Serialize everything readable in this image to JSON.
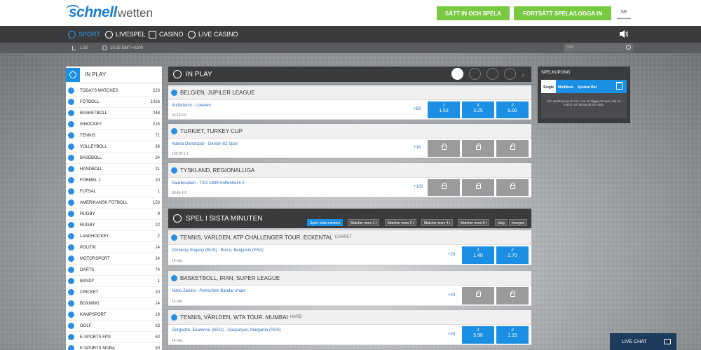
{
  "header": {
    "logo_main": "schnell",
    "logo_sub": "wetten",
    "btn_deposit": "SÄTT IN OCH SPELA",
    "btn_login": "FORTSÄTT SPELA/LOGGA IN",
    "lang": "SE"
  },
  "nav": {
    "sport": "SPORT",
    "livespel": "LIVESPEL",
    "casino": "CASINO",
    "live_casino": "LIVE CASINO"
  },
  "subnav": {
    "odds_format": "1.50",
    "time": "15:15 GMT+0100",
    "search_placeholder": "Sök"
  },
  "sidebar": {
    "title": "IN PLAY",
    "items": [
      {
        "name": "TODAYS MATCHES",
        "count": "223"
      },
      {
        "name": "FOTBOLL",
        "count": "1026"
      },
      {
        "name": "BASKETBOLL",
        "count": "248"
      },
      {
        "name": "ISHOCKEY",
        "count": "215"
      },
      {
        "name": "TENNIS",
        "count": "71"
      },
      {
        "name": "VOLLEYBOLL",
        "count": "36"
      },
      {
        "name": "BASEBOLL",
        "count": "24"
      },
      {
        "name": "HANDBOLL",
        "count": "21"
      },
      {
        "name": "FORMEL 1",
        "count": "20"
      },
      {
        "name": "FUTSAL",
        "count": "1"
      },
      {
        "name": "AMERIKANSK FOTBOLL",
        "count": "153"
      },
      {
        "name": "RUGBY",
        "count": "9"
      },
      {
        "name": "RUGBY",
        "count": "22"
      },
      {
        "name": "LANDHOCKEY",
        "count": "2"
      },
      {
        "name": "POLITIK",
        "count": "14"
      },
      {
        "name": "MOTORSPORT",
        "count": "14"
      },
      {
        "name": "DARTS",
        "count": "74"
      },
      {
        "name": "BANDY",
        "count": "1"
      },
      {
        "name": "CRICKET",
        "count": "20"
      },
      {
        "name": "BOXNING",
        "count": "14"
      },
      {
        "name": "KAMPSPORT",
        "count": "19"
      },
      {
        "name": "GOLF",
        "count": "33"
      },
      {
        "name": "E-SPORTS FPS",
        "count": "63"
      },
      {
        "name": "E-SPORTS MOBA",
        "count": "30"
      }
    ]
  },
  "inplay": {
    "title": "IN PLAY",
    "leagues": [
      {
        "name": "BELGIEN, JUPILER LEAGUE",
        "event": "Anderlecht - Lokeren",
        "time": "43:19 0-0",
        "more": "+83",
        "odds": [
          {
            "lab": "1",
            "val": "1.53"
          },
          {
            "lab": "X",
            "val": "3.25"
          },
          {
            "lab": "2",
            "val": "9.00"
          }
        ]
      },
      {
        "name": "TURKIET, TURKEY CUP",
        "event": "Adana Demirspor - Dersim 62 Spor",
        "time": "106:00 1-1",
        "more": "+18"
      },
      {
        "name": "TYSKLAND, REGIONALLIGA",
        "event": "Saarbrucken - TSG 1899 Hoffenheim II",
        "time": "58:45 4-0",
        "more": "+102"
      }
    ]
  },
  "lastminute": {
    "title": "SPEL I SISTA MINUTEN",
    "tabs": [
      "Spel i sista minuten",
      "Matcher inom 1 t",
      "Matcher inom 2 t",
      "Matcher inom 4 t",
      "Matcher inom 8 t",
      "Idag",
      "Imorgon"
    ],
    "leagues": [
      {
        "name": "TENNIS, VÄRLDEN, ATP CHALLENGER TOUR. ECKENTAL",
        "sub": "CARPET",
        "event": "Donskoy, Evgeny (RUS) - Bonzi, Benjamin (FRA)",
        "time": "14 min.",
        "more": "+20",
        "odds": [
          {
            "lab": "1",
            "val": "1.40"
          },
          {
            "lab": "2",
            "val": "2.70"
          }
        ]
      },
      {
        "name": "BASKETBOLL, IRAN, SUPER LEAGUE",
        "sub": "",
        "event": "Niroo Zamini - Petrochimi Bandar Imam",
        "time": "14 min.",
        "more": "+24"
      },
      {
        "name": "TENNIS, VÄRLDEN, WTA TOUR. MUMBAI",
        "sub": "HARD",
        "event": "Gorgodze, Ekaterine (GEO) - Gasparyan, Margarita (RUS)",
        "time": "14 min.",
        "more": "+20",
        "odds": [
          {
            "lab": "1",
            "val": "5.90"
          },
          {
            "lab": "2",
            "val": "1.15"
          }
        ]
      }
    ]
  },
  "coupon": {
    "title": "SPELKUPONG",
    "tab_single": "Single",
    "tab_multi": "Multibets",
    "tab_system": "System Bet",
    "message": "Din spelkupong är tom. Hur att lägga ett spel, välj en match och klicka på ett odds."
  },
  "chat": {
    "label": "LIVE CHAT"
  }
}
